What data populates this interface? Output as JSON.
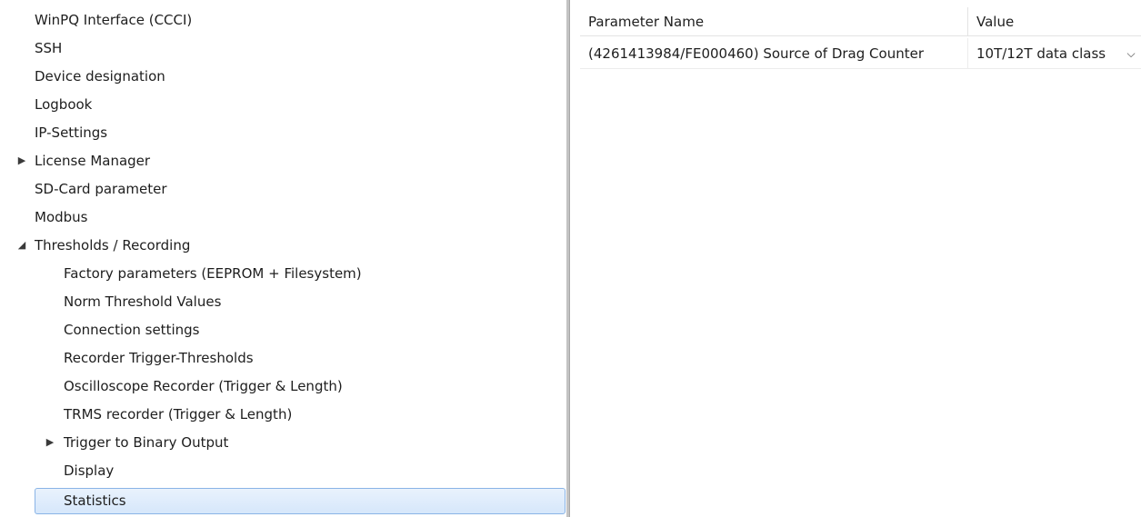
{
  "tree": {
    "items": [
      {
        "label": "WinPQ Interface (CCCI)"
      },
      {
        "label": "SSH"
      },
      {
        "label": "Device designation"
      },
      {
        "label": "Logbook"
      },
      {
        "label": "IP-Settings"
      },
      {
        "label": "License Manager",
        "expander": "collapsed"
      },
      {
        "label": "SD-Card parameter"
      },
      {
        "label": "Modbus"
      },
      {
        "label": "Thresholds / Recording",
        "expander": "expanded"
      },
      {
        "label": "Factory parameters  (EEPROM + Filesystem)"
      },
      {
        "label": "Norm Threshold Values"
      },
      {
        "label": "Connection settings"
      },
      {
        "label": "Recorder Trigger-Thresholds"
      },
      {
        "label": "Oscilloscope Recorder (Trigger & Length)"
      },
      {
        "label": "TRMS recorder (Trigger & Length)"
      },
      {
        "label": "Trigger to Binary Output",
        "expander": "collapsed"
      },
      {
        "label": "Display"
      },
      {
        "label": "Statistics",
        "selected": true
      }
    ],
    "expander_collapsed_glyph": "▶",
    "expander_expanded_glyph": "◢"
  },
  "grid": {
    "headers": {
      "name": "Parameter Name",
      "value": "Value"
    },
    "rows": [
      {
        "name": "(4261413984/FE000460) Source of Drag Counter",
        "value": "10T/12T data class",
        "dropdown_glyph": "⌵"
      }
    ]
  },
  "colors": {
    "selection_border": "#8ab4e6",
    "selection_fill": "#d6e7fb",
    "splitter": "#c3c3c3"
  }
}
